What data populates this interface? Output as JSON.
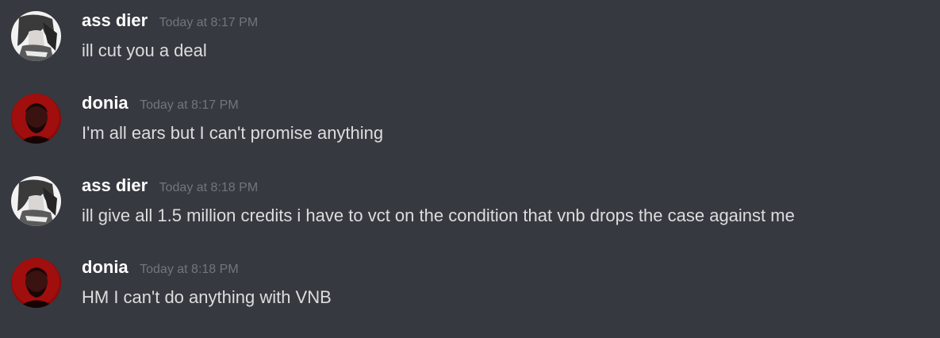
{
  "messages": [
    {
      "author": "ass dier",
      "timestamp": "Today at 8:17 PM",
      "content": "ill cut you a deal",
      "avatar": "anime-avatar"
    },
    {
      "author": "donia",
      "timestamp": "Today at 8:17 PM",
      "content": "I'm all ears but I can't promise anything",
      "avatar": "red-photo-avatar"
    },
    {
      "author": "ass dier",
      "timestamp": "Today at 8:18 PM",
      "content": "ill give all 1.5 million credits i have to vct on the condition that vnb drops the case against me",
      "avatar": "anime-avatar"
    },
    {
      "author": "donia",
      "timestamp": "Today at 8:18 PM",
      "content": "HM I can't do anything with VNB",
      "avatar": "red-photo-avatar"
    }
  ],
  "colors": {
    "background": "#36393f",
    "username": "#ffffff",
    "timestamp": "#72767d",
    "message_text": "#dcddde"
  }
}
